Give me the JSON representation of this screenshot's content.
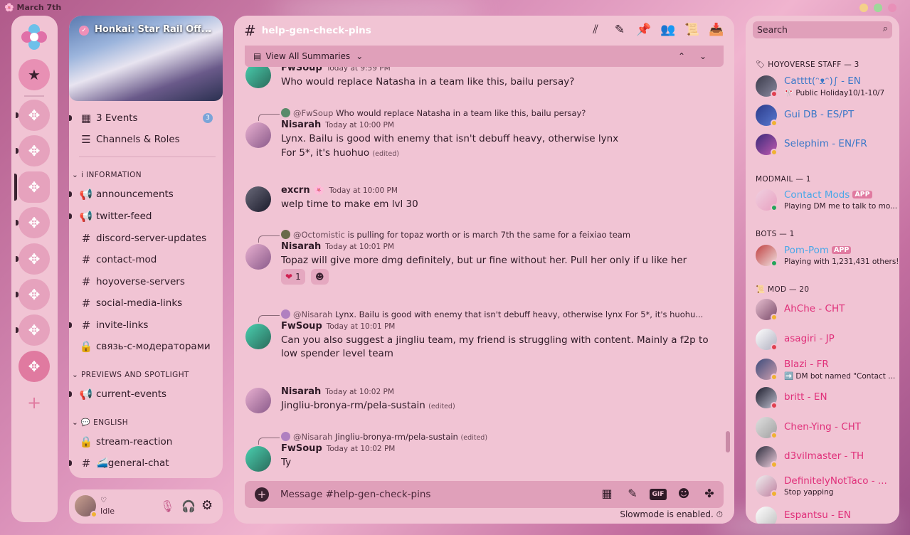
{
  "window": {
    "title": "🌸 March 7th"
  },
  "colors": {
    "accent": "#e0a0ba",
    "panel": "#f1c4d4",
    "link": "#4aa8e8",
    "mod": "#e0307a",
    "staff": "#3a78c8"
  },
  "server": {
    "name": "Honkai: Star Rail Off...",
    "verified_glyph": "✓"
  },
  "rail": {
    "home_icon": "discord-flower-icon",
    "favorites_icon": "star-icon",
    "add_icon": "+"
  },
  "channel_list": {
    "events_label": "3 Events",
    "events_count": "3",
    "channels_roles_label": "Channels & Roles",
    "categories": {
      "information": "i INFORMATION",
      "previews": "PREVIEWS AND SPOTLIGHT",
      "english": "ENGLISH"
    },
    "channels": {
      "announcements": "announcements",
      "twitter_feed": "twitter-feed",
      "discord_server_updates": "discord-server-updates",
      "contact_mod": "contact-mod",
      "hoyoverse_servers": "hoyoverse-servers",
      "social_media_links": "social-media-links",
      "invite_links": "invite-links",
      "mod_contact_ru": "связь-с-модераторами",
      "current_events": "current-events",
      "stream_reaction": "stream-reaction",
      "general_chat": "🚄general-chat"
    }
  },
  "user": {
    "name_glyph": "♡",
    "status": "Idle"
  },
  "chat": {
    "channel_name": "help-gen-check-pins",
    "summaries_label": "View All Summaries",
    "messages": [
      {
        "author": "FwSoup",
        "time": "Today at 9:59 PM",
        "lines": [
          "Who would replace Natasha in a team like this, bailu persay?"
        ]
      },
      {
        "reply_user": "@FwSoup",
        "reply_text": "Who would replace Natasha in a team like this, bailu persay?",
        "author": "Nisarah",
        "time": "Today at 10:00 PM",
        "lines": [
          "Lynx. Bailu is good with enemy that isn't debuff heavy, otherwise lynx",
          "For 5*, it's huohuo"
        ],
        "edited": "(edited)"
      },
      {
        "author": "excrn",
        "time": "Today at 10:00 PM",
        "lines": [
          "welp time to make em lvl 30"
        ]
      },
      {
        "reply_user": "@Octomistic",
        "reply_text": "is pulling for topaz worth or is march 7th the same for a feixiao team",
        "author": "Nisarah",
        "time": "Today at 10:01 PM",
        "lines": [
          "Topaz will give more dmg definitely, but ur fine without her. Pull her only if u like her"
        ],
        "reaction_count": "1"
      },
      {
        "reply_user": "@Nisarah",
        "reply_text": "Lynx. Bailu is good with enemy that isn't debuff heavy, otherwise lynx For 5*, it's huohu...",
        "author": "FwSoup",
        "time": "Today at 10:01 PM",
        "lines": [
          "Can you also suggest a jingliu team, my friend is struggling with content. Mainly a f2p to",
          "low spender level team"
        ]
      },
      {
        "author": "Nisarah",
        "time": "Today at 10:02 PM",
        "lines": [
          "Jingliu-bronya-rm/pela-sustain"
        ],
        "edited": "(edited)"
      },
      {
        "reply_user": "@Nisarah",
        "reply_text": "Jingliu-bronya-rm/pela-sustain",
        "reply_edited": "(edited)",
        "author": "FwSoup",
        "time": "Today at 10:02 PM",
        "lines": [
          "Ty"
        ]
      }
    ],
    "composer_placeholder": "Message #help-gen-check-pins",
    "gif_label": "GIF",
    "slowmode": "Slowmode is enabled."
  },
  "members": {
    "search_placeholder": "Search",
    "groups": [
      {
        "label": "HOYOVERSE STAFF — 3",
        "members": [
          {
            "name": "Catttt(ᵔᴥᵔ)∫ - EN",
            "activity": "🎌 Public Holiday10/1-10/7",
            "status": "dnd"
          },
          {
            "name": "Gui DB - ES/PT",
            "status": "idle"
          },
          {
            "name": "Selephim - EN/FR",
            "status": "idle"
          }
        ]
      },
      {
        "label": "MODMAIL — 1",
        "members": [
          {
            "name": "Contact Mods",
            "tag": "APP",
            "activity": "Playing DM me to talk to mo...",
            "status": "online"
          }
        ]
      },
      {
        "label": "BOTS — 1",
        "members": [
          {
            "name": "Pom-Pom",
            "tag": "APP",
            "activity": "Playing with 1,231,431 others!",
            "status": "online"
          }
        ]
      },
      {
        "label": "MOD — 20",
        "members": [
          {
            "name": "AhChe - CHT",
            "status": "idle"
          },
          {
            "name": "asagiri - JP",
            "status": "dnd"
          },
          {
            "name": "Blazi - FR",
            "activity": "➡️ DM bot named \"Contact ...",
            "status": "idle"
          },
          {
            "name": "britt - EN",
            "status": "dnd"
          },
          {
            "name": "Chen-Ying - CHT",
            "status": "idle"
          },
          {
            "name": "d3vilmaster - TH",
            "status": "idle"
          },
          {
            "name": "DefinitelyNotTaco - ...",
            "activity": "Stop yapping",
            "status": "idle"
          },
          {
            "name": "Espantsu - EN",
            "status": "idle"
          }
        ]
      }
    ]
  }
}
